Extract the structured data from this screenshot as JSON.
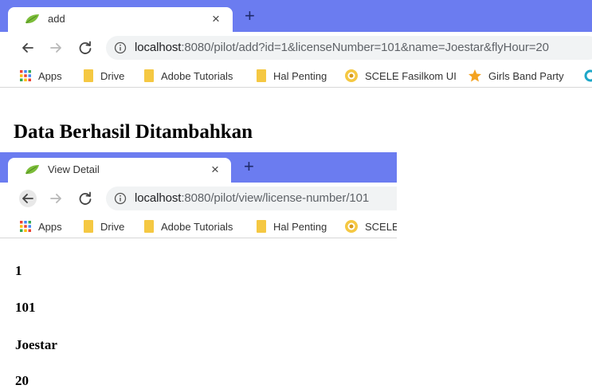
{
  "window1": {
    "tab_title": "add",
    "tab_close": "×",
    "new_tab": "+",
    "url_host": "localhost",
    "url_rest": ":8080/pilot/add?id=1&licenseNumber=101&name=Joestar&flyHour=20",
    "bookmarks": [
      "Apps",
      "Drive",
      "Adobe Tutorials",
      "Hal Penting",
      "SCELE Fasilkom UI",
      "Girls Band Party"
    ]
  },
  "page1": {
    "heading": "Data Berhasil Ditambahkan"
  },
  "window2": {
    "tab_title": "View Detail",
    "tab_close": "×",
    "new_tab": "+",
    "url_host": "localhost",
    "url_rest": ":8080/pilot/view/license-number/101",
    "bookmarks": [
      "Apps",
      "Drive",
      "Adobe Tutorials",
      "Hal Penting",
      "SCELE"
    ]
  },
  "page2": {
    "id": "1",
    "license_number": "101",
    "name": "Joestar",
    "fly_hour": "20"
  },
  "colors": {
    "tabstrip": "#6b7cf0",
    "folder": "#f5c842",
    "star": "#f4a320"
  }
}
